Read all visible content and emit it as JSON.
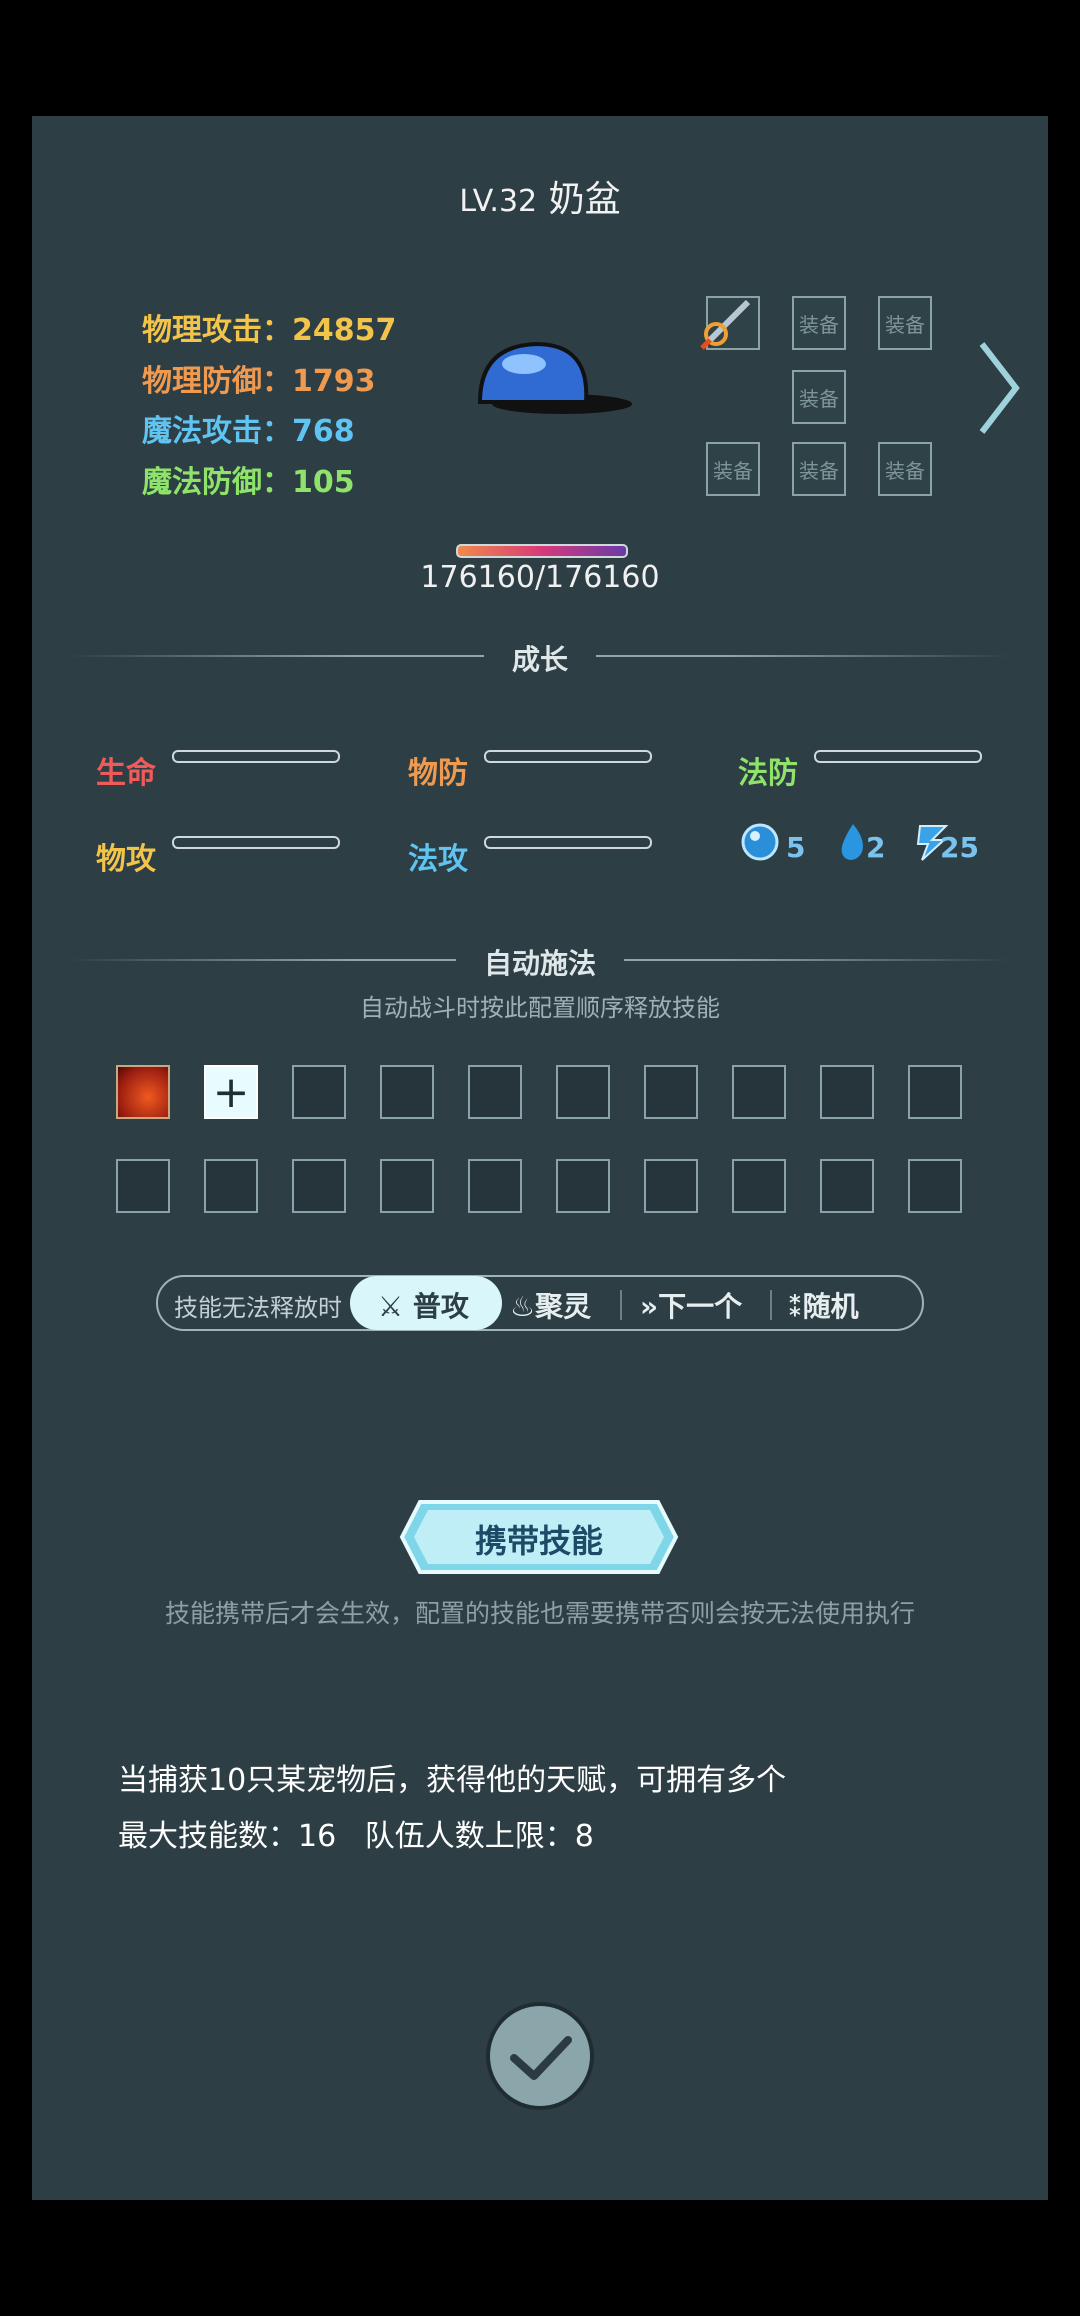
{
  "pet": {
    "level": "LV.32",
    "name": "奶盆"
  },
  "stats": [
    {
      "label": "物理攻击：",
      "value": "24857",
      "color": "#f3c44a"
    },
    {
      "label": "物理防御：",
      "value": "1793",
      "color": "#f09a50"
    },
    {
      "label": "魔法攻击：",
      "value": "768",
      "color": "#5fc4f2"
    },
    {
      "label": "魔法防御：",
      "value": "105",
      "color": "#8fe36a"
    }
  ],
  "equipment": {
    "slot_label": "装备"
  },
  "hp": {
    "text": "176160/176160",
    "fraction": 1.0
  },
  "growth": {
    "title": "成长",
    "labels": [
      {
        "text": "生命",
        "color": "#f05a5a"
      },
      {
        "text": "物防",
        "color": "#f09a50"
      },
      {
        "text": "法防",
        "color": "#8fe36a"
      },
      {
        "text": "物攻",
        "color": "#f3c44a"
      },
      {
        "text": "法攻",
        "color": "#5fc4f2"
      }
    ],
    "resources": [
      "5",
      "2",
      "25"
    ]
  },
  "auto_cast": {
    "title": "自动施法",
    "subtitle": "自动战斗时按此配置顺序释放技能",
    "add_label": "+"
  },
  "fallback": {
    "label": "技能无法释放时",
    "options": [
      "普攻",
      "聚灵",
      "下一个",
      "随机"
    ],
    "selected": "普攻"
  },
  "carry": {
    "button": "携带技能",
    "note": "技能携带后才会生效，配置的技能也需要携带否则会按无法使用执行"
  },
  "info": {
    "line1": "当捕获10只某宠物后，获得他的天赋，可拥有多个",
    "line2": "最大技能数：16   队伍人数上限：8"
  }
}
